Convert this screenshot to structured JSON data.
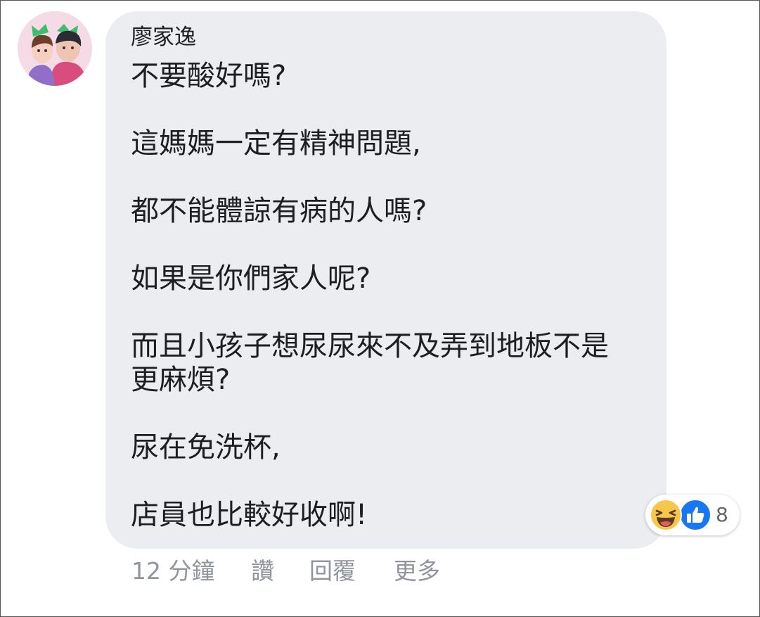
{
  "comment": {
    "author": "廖家逸",
    "paragraphs": [
      [
        "不要酸好嗎?"
      ],
      [
        "這媽媽一定有精神問題,"
      ],
      [
        "都不能體諒有病的人嗎?"
      ],
      [
        "如果是你們家人呢?"
      ],
      [
        "而且小孩子想尿尿來不及弄到地板不是",
        "更麻煩?"
      ],
      [
        "尿在免洗杯,"
      ],
      [
        "店員也比較好收啊!"
      ]
    ]
  },
  "reactions": {
    "icons": [
      "haha-icon",
      "like-icon"
    ],
    "count": "8"
  },
  "actions": {
    "time": "12 分鐘",
    "like": "讚",
    "reply": "回覆",
    "more": "更多"
  },
  "colors": {
    "bubble": "#ebedf0",
    "text": "#1c1e21",
    "meta": "#90949c",
    "like_blue": "#1877f2",
    "haha_yellow": "#f7c74b"
  }
}
